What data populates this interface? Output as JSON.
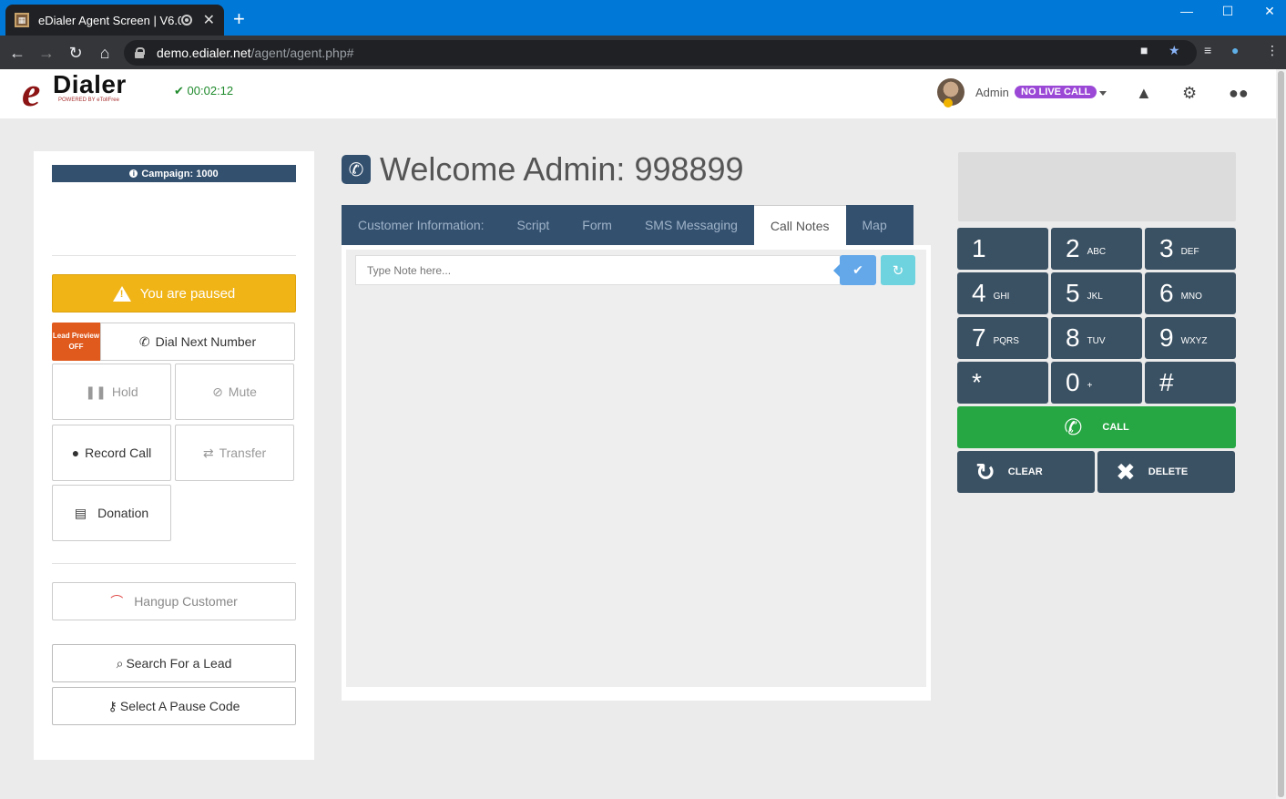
{
  "browser": {
    "tab_title": "eDialer Agent Screen | V6.0",
    "url_host": "demo.edialer.net",
    "url_path": "/agent/agent.php#"
  },
  "header": {
    "logo_letter": "e",
    "logo_text": "Dialer",
    "logo_sub": "POWERED BY eTollFree",
    "timer": "00:02:12",
    "admin_name": "Admin",
    "status_badge": "NO LIVE CALL"
  },
  "left": {
    "campaign": "Campaign: 1000",
    "paused": "You are paused",
    "lead_preview_line1": "Lead Preview",
    "lead_preview_line2": "OFF",
    "dial_next": "Dial Next Number",
    "hold": "Hold",
    "mute": "Mute",
    "record_call": "Record Call",
    "transfer": "Transfer",
    "donation": "Donation",
    "hangup": "Hangup Customer",
    "search_lead": "Search For a Lead",
    "pause_code": "Select A Pause Code"
  },
  "center": {
    "welcome": "Welcome Admin: 998899",
    "tabs": [
      "Customer Information:",
      "Script",
      "Form",
      "SMS Messaging",
      "Call Notes",
      "Map"
    ],
    "active_tab": "Call Notes",
    "note_placeholder": "Type Note here..."
  },
  "dialpad": {
    "keys": [
      {
        "num": "1",
        "letters": ""
      },
      {
        "num": "2",
        "letters": "ABC"
      },
      {
        "num": "3",
        "letters": "DEF"
      },
      {
        "num": "4",
        "letters": "GHI"
      },
      {
        "num": "5",
        "letters": "JKL"
      },
      {
        "num": "6",
        "letters": "MNO"
      },
      {
        "num": "7",
        "letters": "PQRS"
      },
      {
        "num": "8",
        "letters": "TUV"
      },
      {
        "num": "9",
        "letters": "WXYZ"
      },
      {
        "num": "*",
        "letters": ""
      },
      {
        "num": "0",
        "letters": "+"
      },
      {
        "num": "#",
        "letters": ""
      }
    ],
    "call": "CALL",
    "clear": "CLEAR",
    "delete": "DELETE"
  },
  "colors": {
    "brand_blue": "#33506f",
    "paused_yellow": "#f0b417",
    "call_green": "#27a744",
    "status_purple": "#9b48d6",
    "lead_preview_orange": "#e05a1e"
  }
}
